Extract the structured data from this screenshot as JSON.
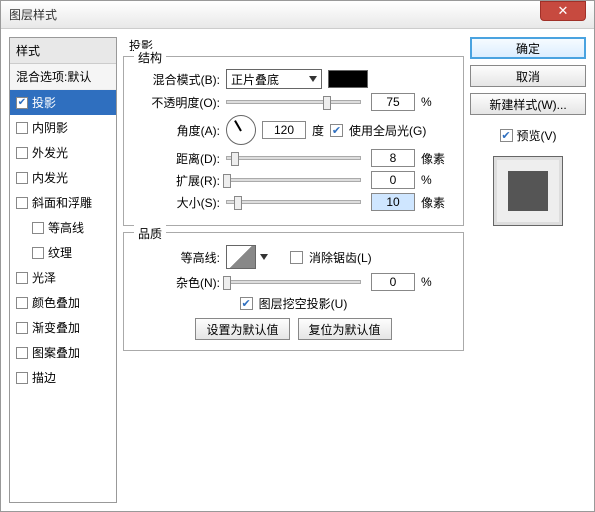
{
  "window": {
    "title": "图层样式"
  },
  "left": {
    "header": "样式",
    "sub": "混合选项:默认",
    "items": [
      {
        "label": "投影",
        "checked": true,
        "selected": true
      },
      {
        "label": "内阴影",
        "checked": false
      },
      {
        "label": "外发光",
        "checked": false
      },
      {
        "label": "内发光",
        "checked": false
      },
      {
        "label": "斜面和浮雕",
        "checked": false
      },
      {
        "label": "等高线",
        "checked": false,
        "child": true
      },
      {
        "label": "纹理",
        "checked": false,
        "child": true
      },
      {
        "label": "光泽",
        "checked": false
      },
      {
        "label": "颜色叠加",
        "checked": false
      },
      {
        "label": "渐变叠加",
        "checked": false
      },
      {
        "label": "图案叠加",
        "checked": false
      },
      {
        "label": "描边",
        "checked": false
      }
    ]
  },
  "mid": {
    "title": "投影",
    "group1": {
      "legend": "结构",
      "blend": {
        "label": "混合模式(B):",
        "value": "正片叠底"
      },
      "opacity": {
        "label": "不透明度(O):",
        "value": "75",
        "unit": "%"
      },
      "angle": {
        "label": "角度(A):",
        "value": "120",
        "unitlabel": "度",
        "global_label": "使用全局光(G)",
        "global_checked": true
      },
      "distance": {
        "label": "距离(D):",
        "value": "8",
        "unit": "像素"
      },
      "spread": {
        "label": "扩展(R):",
        "value": "0",
        "unit": "%"
      },
      "size": {
        "label": "大小(S):",
        "value": "10",
        "unit": "像素"
      }
    },
    "group2": {
      "legend": "品质",
      "contour": {
        "label": "等高线:",
        "aa_label": "消除锯齿(L)",
        "aa_checked": false
      },
      "noise": {
        "label": "杂色(N):",
        "value": "0",
        "unit": "%"
      },
      "knockout": {
        "label": "图层挖空投影(U)",
        "checked": true
      },
      "btn_default": "设置为默认值",
      "btn_reset": "复位为默认值"
    }
  },
  "right": {
    "ok": "确定",
    "cancel": "取消",
    "newstyle": "新建样式(W)...",
    "preview_label": "预览(V)",
    "preview_checked": true
  }
}
